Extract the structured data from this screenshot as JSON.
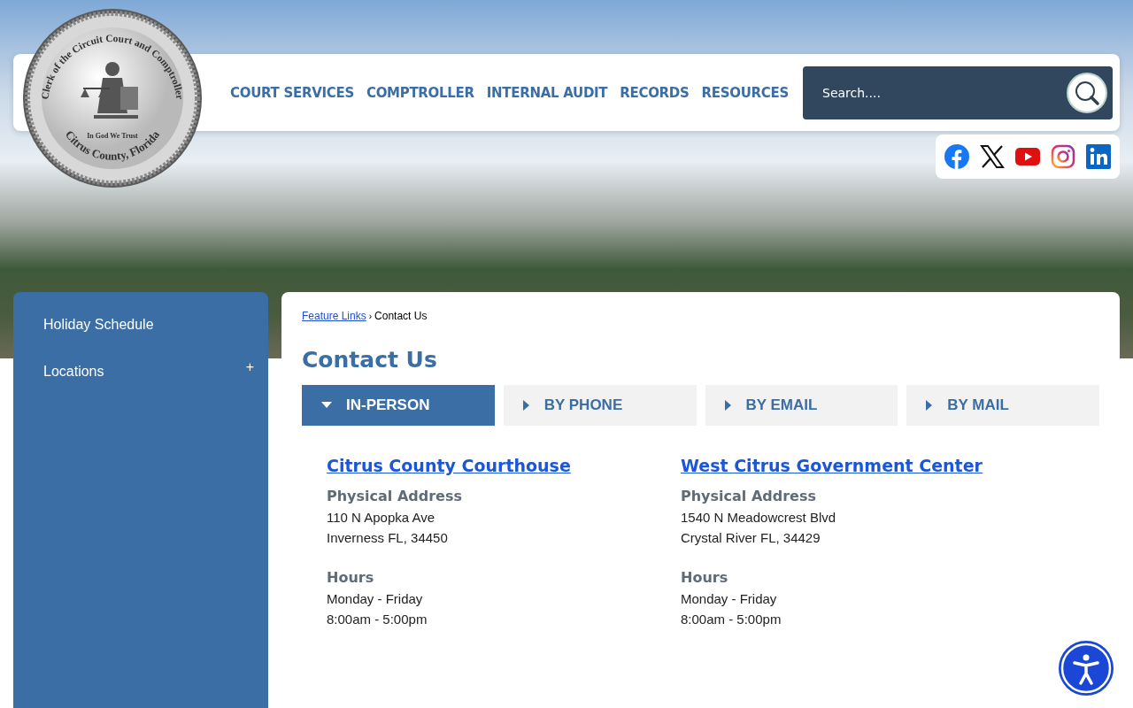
{
  "seal": {
    "top_text": "Clerk of the Circuit Court and Comptroller",
    "motto": "In God We Trust",
    "bottom_text": "Citrus County, Florida"
  },
  "nav": [
    "COURT SERVICES",
    "COMPTROLLER",
    "INTERNAL AUDIT",
    "RECORDS",
    "RESOURCES"
  ],
  "search": {
    "placeholder": "Search...."
  },
  "social": [
    {
      "kind": "facebook"
    },
    {
      "kind": "x"
    },
    {
      "kind": "youtube"
    },
    {
      "kind": "instagram"
    },
    {
      "kind": "linkedin"
    }
  ],
  "sidebar": {
    "items": [
      {
        "label": "Holiday Schedule"
      },
      {
        "label": "Locations",
        "toggle": "+"
      }
    ]
  },
  "breadcrumb": {
    "link": "Feature Links",
    "separator": "›",
    "current": "Contact Us"
  },
  "page_title": "Contact Us",
  "tabs": [
    {
      "label": "IN-PERSON",
      "selected": true
    },
    {
      "label": "BY PHONE",
      "selected": false
    },
    {
      "label": "BY EMAIL",
      "selected": false
    },
    {
      "label": "BY MAIL",
      "selected": false
    }
  ],
  "locations": [
    {
      "name": "Citrus County Courthouse",
      "sections": [
        {
          "heading": "Physical Address",
          "lines": [
            "110 N Apopka Ave",
            "Inverness FL, 34450"
          ]
        },
        {
          "heading": "Hours",
          "lines": [
            "Monday - Friday",
            "8:00am - 5:00pm"
          ]
        }
      ]
    },
    {
      "name": "West Citrus Government Center",
      "sections": [
        {
          "heading": "Physical Address",
          "lines": [
            "1540 N Meadowcrest Blvd",
            "Crystal River FL, 34429"
          ]
        },
        {
          "heading": "Hours",
          "lines": [
            "Monday - Friday",
            "8:00am - 5:00pm"
          ]
        }
      ]
    }
  ]
}
